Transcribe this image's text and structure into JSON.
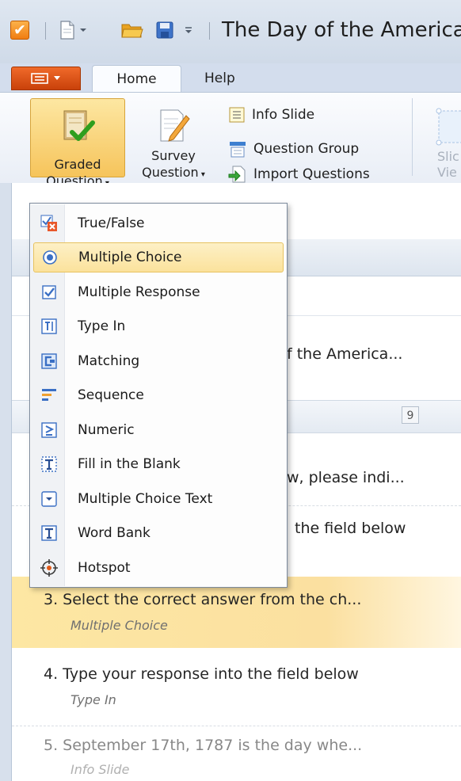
{
  "titlebar": {
    "title": "The Day of the America"
  },
  "tabs": {
    "home": "Home",
    "help": "Help"
  },
  "ribbon": {
    "graded_line1": "Graded",
    "graded_line2": "Question",
    "survey_line1": "Survey",
    "survey_line2": "Question",
    "info_slide": "Info Slide",
    "question_group": "Question Group",
    "import_questions": "Import Questions",
    "cut_line1": "Slic",
    "cut_line2": "Vie"
  },
  "menu": {
    "items": [
      {
        "label": "True/False",
        "icon": "true-false-icon"
      },
      {
        "label": "Multiple Choice",
        "icon": "multiple-choice-icon"
      },
      {
        "label": "Multiple Response",
        "icon": "multiple-response-icon"
      },
      {
        "label": "Type In",
        "icon": "type-in-icon"
      },
      {
        "label": "Matching",
        "icon": "matching-icon"
      },
      {
        "label": "Sequence",
        "icon": "sequence-icon"
      },
      {
        "label": "Numeric",
        "icon": "numeric-icon"
      },
      {
        "label": "Fill in the Blank",
        "icon": "fill-in-blank-icon"
      },
      {
        "label": "Multiple Choice Text",
        "icon": "multiple-choice-text-icon"
      },
      {
        "label": "Word Bank",
        "icon": "word-bank-icon"
      },
      {
        "label": "Hotspot",
        "icon": "hotspot-icon"
      }
    ]
  },
  "content": {
    "row_partial_1": "f the America...",
    "group_count": "9",
    "row_partial_2": "w, please indi...",
    "row_partial_3": "the field below"
  },
  "questions": [
    {
      "title": "3. Select the correct answer from the ch...",
      "type": "Multiple Choice"
    },
    {
      "title": "4. Type your response into the field below",
      "type": "Type In"
    },
    {
      "title": "5. September 17th, 1787 is the day whe...",
      "type": "Info Slide"
    }
  ],
  "colors": {
    "accent_orange": "#f07d12",
    "selection": "#fbe29c"
  }
}
